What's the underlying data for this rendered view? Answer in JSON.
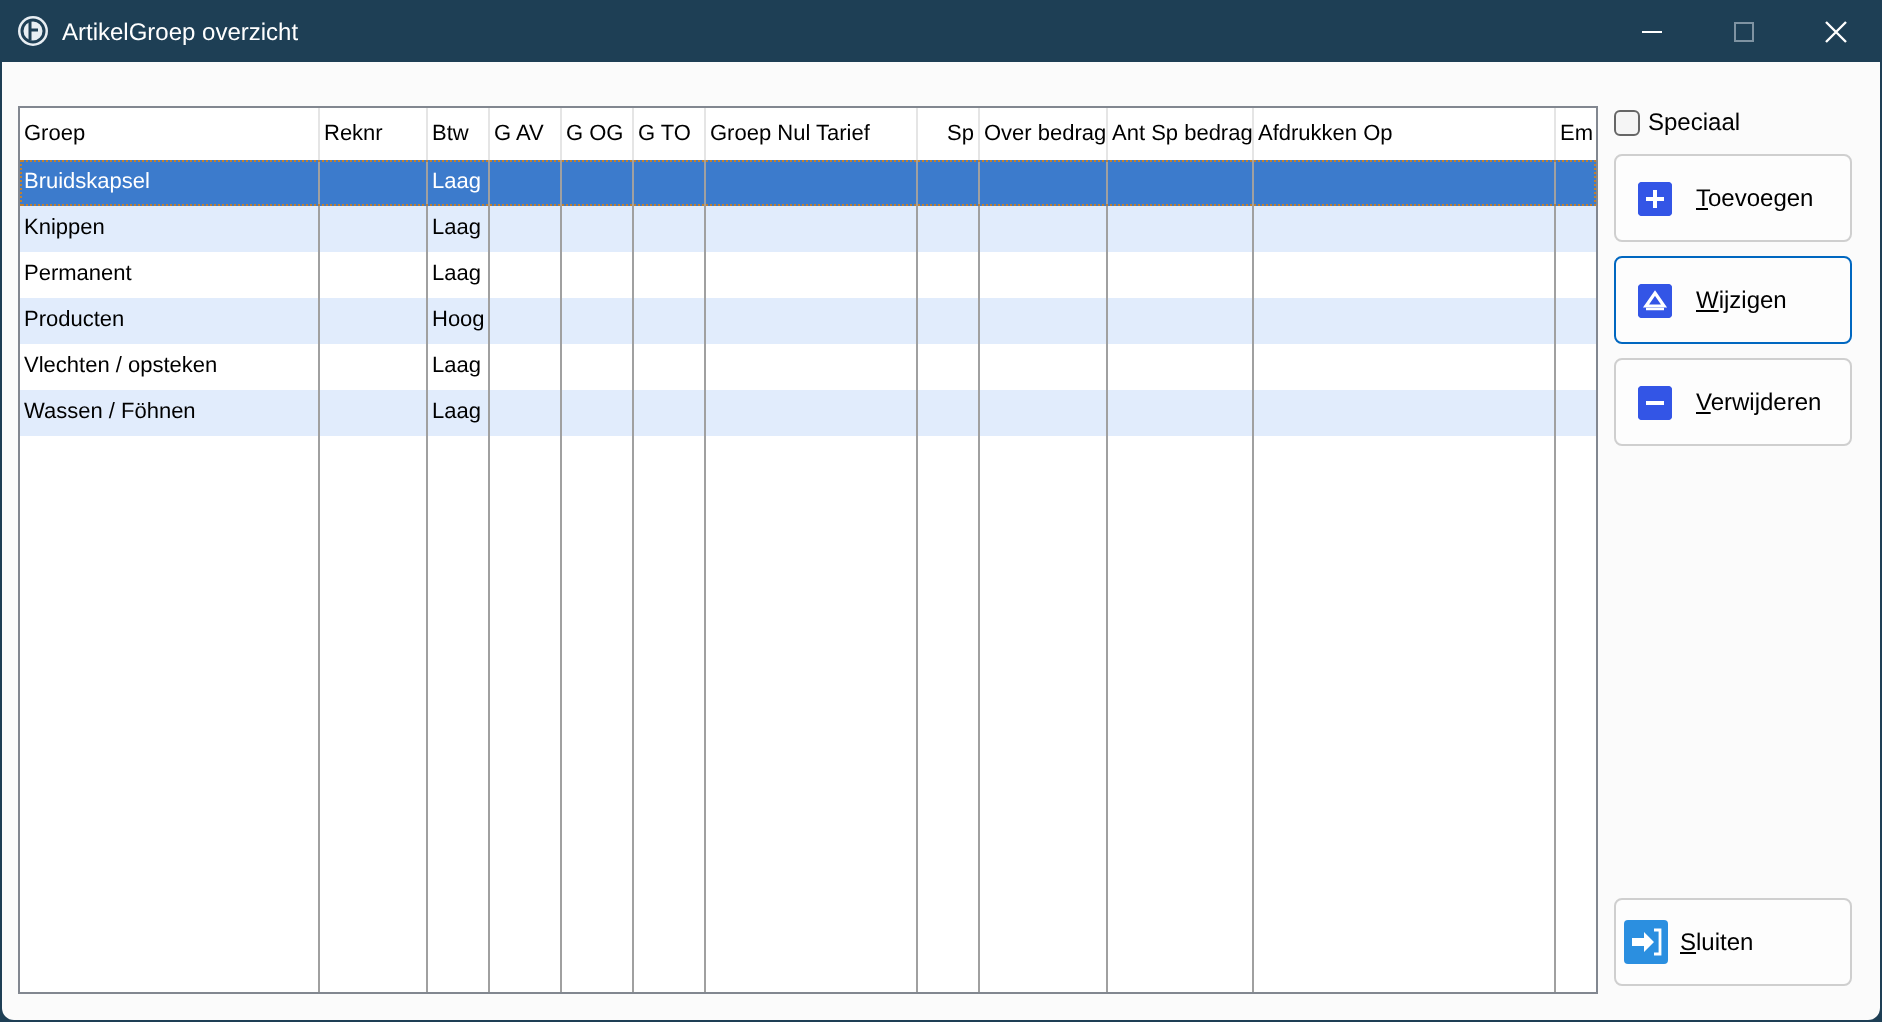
{
  "window": {
    "title": "ArtikelGroep overzicht"
  },
  "table": {
    "columns": [
      {
        "label": "Groep",
        "kind": "text"
      },
      {
        "label": "Reknr",
        "kind": "text"
      },
      {
        "label": "Btw",
        "kind": "text"
      },
      {
        "label": "G AV",
        "kind": "text"
      },
      {
        "label": "G OG",
        "kind": "text"
      },
      {
        "label": "G TO",
        "kind": "text"
      },
      {
        "label": "Groep Nul Tarief",
        "kind": "text"
      },
      {
        "label": "Sp",
        "kind": "number"
      },
      {
        "label": "Over bedrag",
        "kind": "text"
      },
      {
        "label": "Ant Sp bedrag",
        "kind": "text"
      },
      {
        "label": "Afdrukken Op",
        "kind": "text"
      },
      {
        "label": "Em",
        "kind": "text"
      }
    ],
    "rows": [
      {
        "selected": true,
        "cells": [
          "Bruidskapsel",
          "",
          "Laag"
        ]
      },
      {
        "selected": false,
        "cells": [
          "Knippen",
          "",
          "Laag"
        ]
      },
      {
        "selected": false,
        "cells": [
          "Permanent",
          "",
          "Laag"
        ]
      },
      {
        "selected": false,
        "cells": [
          "Producten",
          "",
          "Hoog"
        ]
      },
      {
        "selected": false,
        "cells": [
          "Vlechten / opsteken",
          "",
          "Laag"
        ]
      },
      {
        "selected": false,
        "cells": [
          "Wassen / Föhnen",
          "",
          "Laag"
        ]
      }
    ]
  },
  "special": {
    "label": "Speciaal",
    "checked": false
  },
  "buttons": [
    {
      "kind": "add",
      "label": "Toevoegen",
      "focused": false
    },
    {
      "kind": "edit",
      "label": "Wijzigen",
      "focused": true
    },
    {
      "kind": "remove",
      "label": "Verwijderen",
      "focused": false
    }
  ],
  "close_button": {
    "label": "Sluiten"
  }
}
